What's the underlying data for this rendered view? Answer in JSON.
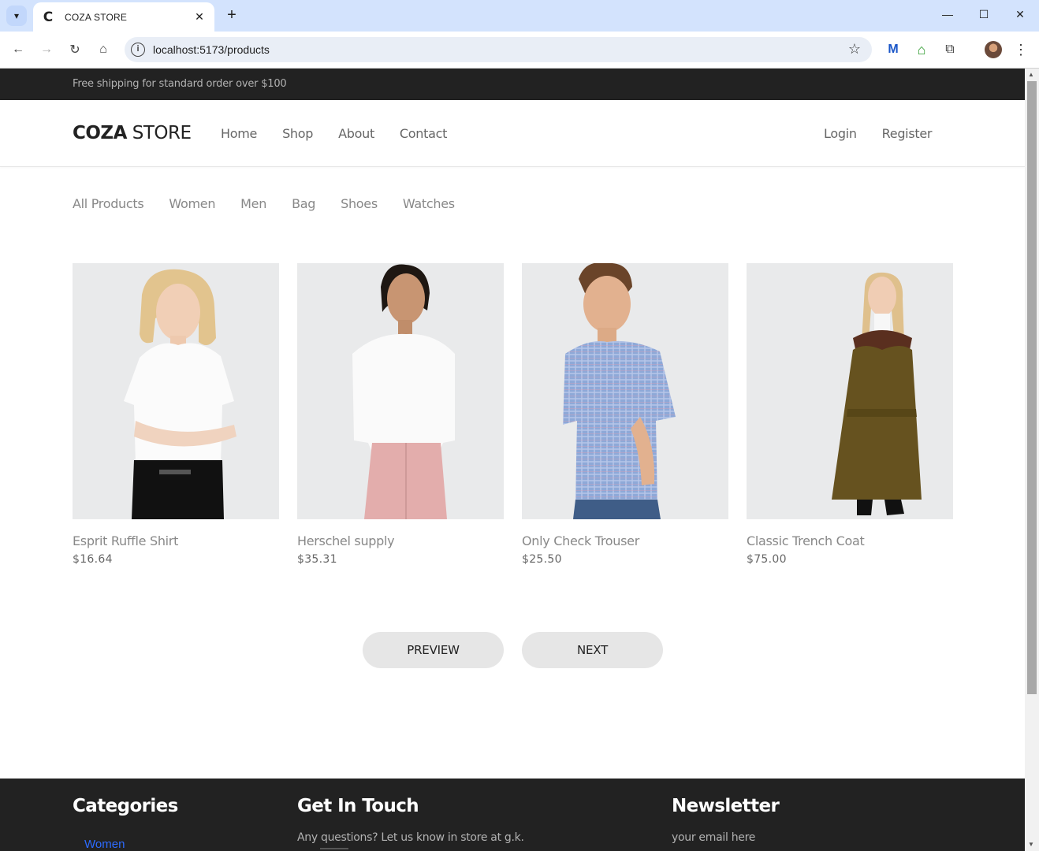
{
  "browser": {
    "tab_title": "COZA STORE",
    "tab_favicon": "C",
    "url": "localhost:5173/products",
    "icons": {
      "tab_search": "▾",
      "close_tab": "✕",
      "new_tab": "+",
      "minimize": "—",
      "maximize": "☐",
      "close_window": "✕",
      "back": "←",
      "forward": "→",
      "reload": "↻",
      "home": "⌂",
      "info": "i",
      "star": "☆",
      "gmail": "M",
      "house_ext": "⌂",
      "puzzle": "⧉",
      "menu": "⋮"
    }
  },
  "topbar": {
    "text": "Free shipping for standard order over $100"
  },
  "header": {
    "logo_bold": "COZA",
    "logo_light": " STORE",
    "nav": [
      "Home",
      "Shop",
      "About",
      "Contact"
    ],
    "auth": [
      "Login",
      "Register"
    ]
  },
  "filters": [
    "All Products",
    "Women",
    "Men",
    "Bag",
    "Shoes",
    "Watches"
  ],
  "products": [
    {
      "name": "Esprit Ruffle Shirt",
      "price": "$16.64"
    },
    {
      "name": "Herschel supply",
      "price": "$35.31"
    },
    {
      "name": "Only Check Trouser",
      "price": "$25.50"
    },
    {
      "name": "Classic Trench Coat",
      "price": "$75.00"
    }
  ],
  "pager": {
    "prev": "PREVIEW",
    "next": "NEXT"
  },
  "footer": {
    "categories_title": "Categories",
    "categories_first": "Women",
    "touch_title": "Get In Touch",
    "touch_text": "Any questions? Let us know in store at g.k.",
    "newsletter_title": "Newsletter",
    "newsletter_placeholder": "your email here"
  },
  "colors": {
    "topbar_bg": "#222222",
    "footer_bg": "#222222",
    "link": "#2d6bff",
    "button_bg": "#e6e6e6"
  }
}
